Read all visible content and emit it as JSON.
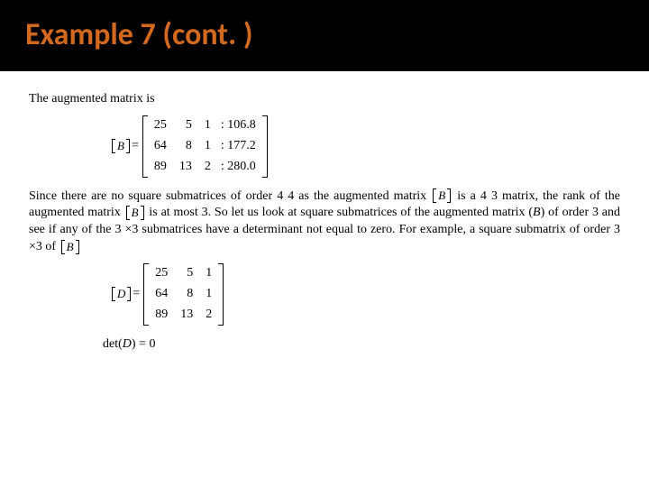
{
  "title": "Example 7 (cont. )",
  "intro": "The augmented matrix is",
  "matrixB": {
    "label_left": "[",
    "label_sym": "B",
    "label_right": "]",
    "eq": "=",
    "rows": [
      {
        "c0": "25",
        "c1": "5",
        "c2": "1",
        "aug": ": 106.8"
      },
      {
        "c0": "64",
        "c1": "8",
        "c2": "1",
        "aug": ": 177.2"
      },
      {
        "c0": "89",
        "c1": "13",
        "c2": "2",
        "aug": ": 280.0"
      }
    ]
  },
  "para1_a": "Since there are no square submatrices of order 4   4 as the augmented matrix ",
  "para1_b": " is a  4   3 matrix, the rank of the augmented matrix ",
  "para1_c": " is at most 3. So let us look at square submatrices of the augmented matrix (",
  "para1_B": "B",
  "para1_d": ") of order 3 and see if any of the 3 ×3 submatrices have a determinant not equal to zero.  For example, a square submatrix of order  3 ×3 of ",
  "matrixD": {
    "label_sym": "D",
    "eq": "=",
    "rows": [
      {
        "c0": "25",
        "c1": "5",
        "c2": "1"
      },
      {
        "c0": "64",
        "c1": "8",
        "c2": "1"
      },
      {
        "c0": "89",
        "c1": "13",
        "c2": "2"
      }
    ]
  },
  "det_line_a": "det(",
  "det_line_D": "D",
  "det_line_b": ") = 0"
}
